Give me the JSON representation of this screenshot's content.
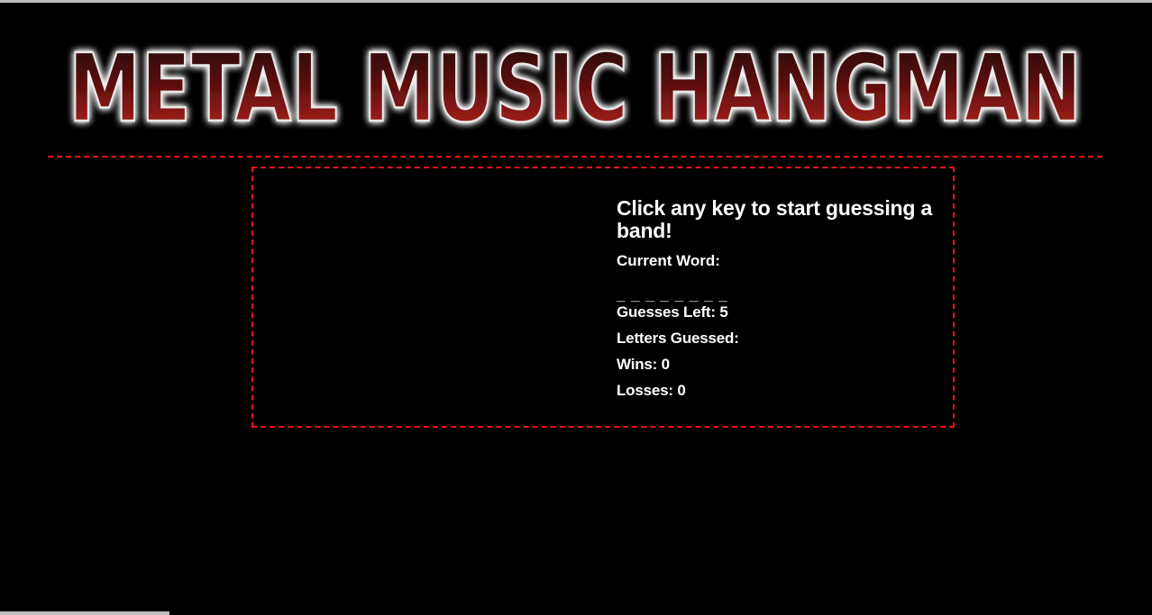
{
  "header": {
    "logo_text": "METAL MUSIC HANGMAN"
  },
  "game": {
    "prompt": "Click any key to start guessing a band!",
    "current_word_label": "Current Word:",
    "current_word_value": "_ _ _ _ _ _ _ _",
    "guesses_left_label": "Guesses Left:",
    "guesses_left": "5",
    "letters_guessed_label": "Letters Guessed:",
    "letters_guessed": "",
    "wins_label": "Wins:",
    "wins": "0",
    "losses_label": "Losses:",
    "losses": "0"
  },
  "colors": {
    "background": "#000000",
    "accent": "#e8131a",
    "text": "#ffffff",
    "logo_fill_top": "#1e0707",
    "logo_fill_bottom": "#b3201e"
  }
}
